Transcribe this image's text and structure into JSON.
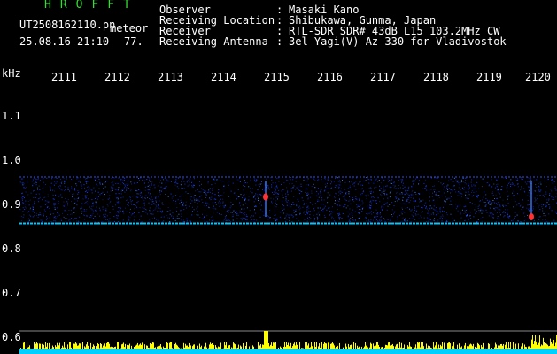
{
  "station": {
    "logo": "HROFFT",
    "filename": "UT2508162110.pn",
    "detector": "meteor",
    "datetime": "25.08.16 21:10",
    "count": "77."
  },
  "header": {
    "rows": [
      {
        "label": "Observer",
        "value": "Masaki Kano"
      },
      {
        "label": "Receiving Location",
        "value": "Shibukawa, Gunma, Japan"
      },
      {
        "label": "Receiver",
        "value": "RTL-SDR SDR# 43dB L15 103.2MHz CW"
      },
      {
        "label": "Receiving Antenna",
        "value": "3el Yagi(V) Az 330 for Vladivostok"
      }
    ]
  },
  "chart_data": {
    "type": "heatmap",
    "ylabel": "kHz",
    "x_ticks": [
      "2111",
      "2112",
      "2113",
      "2114",
      "2115",
      "2116",
      "2117",
      "2118",
      "2119",
      "2120"
    ],
    "y_ticks": [
      "1.1",
      "1.0",
      "0.9",
      "0.8",
      "0.7",
      "0.6"
    ],
    "ylim": [
      0.6,
      1.2
    ],
    "carrier_freq_khz": 0.855,
    "noise_band_khz": [
      0.855,
      0.96
    ],
    "echoes": [
      {
        "minute": 2115.0,
        "freq_khz": 0.915,
        "color": "#ff3333"
      },
      {
        "minute": 2120.0,
        "freq_khz": 0.87,
        "color": "#ff3333"
      }
    ],
    "colors": {
      "background": "#000000",
      "noise": "#1a3cff",
      "carrier": "#00c8ff",
      "histogram": "#ffff00",
      "histogram_base": "#00d0ff"
    }
  }
}
